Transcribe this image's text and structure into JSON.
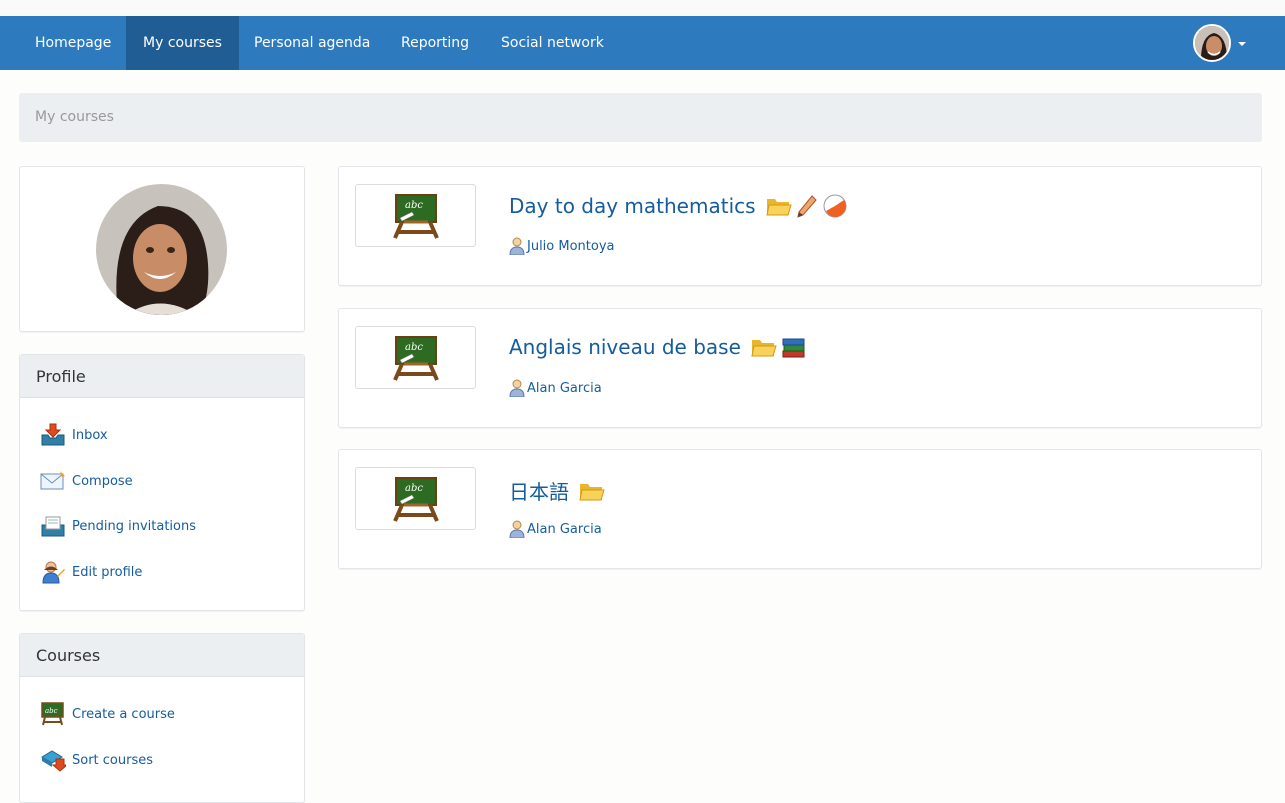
{
  "nav": {
    "items": [
      {
        "label": "Homepage"
      },
      {
        "label": "My courses"
      },
      {
        "label": "Personal agenda"
      },
      {
        "label": "Reporting"
      },
      {
        "label": "Social network"
      }
    ],
    "active": "My courses"
  },
  "breadcrumb": "My courses",
  "profile_panel": {
    "title": "Profile",
    "items": [
      {
        "label": "Inbox",
        "icon": "inbox-icon"
      },
      {
        "label": "Compose",
        "icon": "envelope-icon"
      },
      {
        "label": "Pending invitations",
        "icon": "invitations-icon"
      },
      {
        "label": "Edit profile",
        "icon": "user-edit-icon"
      }
    ]
  },
  "courses_panel": {
    "title": "Courses",
    "items": [
      {
        "label": "Create a course",
        "icon": "blackboard-icon"
      },
      {
        "label": "Sort courses",
        "icon": "sort-icon"
      }
    ]
  },
  "courses": [
    {
      "title": "Day to day mathematics",
      "teacher": "Julio Montoya",
      "icons": [
        "folder-icon",
        "pencil-icon",
        "quiz-icon"
      ]
    },
    {
      "title": "Anglais niveau de base",
      "teacher": "Alan Garcia",
      "icons": [
        "folder-icon",
        "books-icon"
      ]
    },
    {
      "title": "日本語",
      "teacher": "Alan Garcia",
      "icons": [
        "folder-icon"
      ]
    }
  ],
  "colors": {
    "navbar": "#2d7abf",
    "nav_active": "#1f5d94",
    "link": "#145c9e",
    "panel_head": "#ebeff2"
  }
}
